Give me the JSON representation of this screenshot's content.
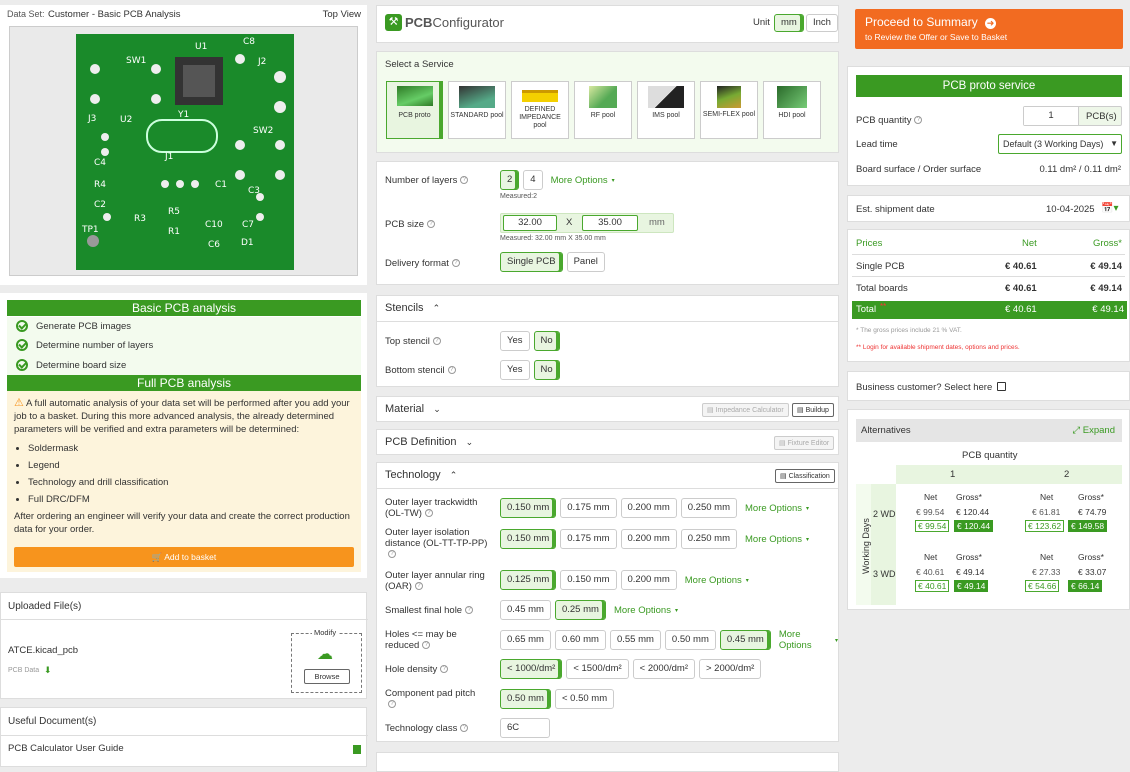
{
  "left": {
    "dataset_label": "Data Set:",
    "dataset_name": "Customer - Basic PCB Analysis",
    "view": "Top View",
    "pcb_labels": [
      "SW1",
      "U1",
      "C8",
      "J2",
      "J3",
      "U2",
      "Y1",
      "SW2",
      "C4",
      "J1",
      "R4",
      "C1",
      "C3",
      "C2",
      "R3",
      "R5",
      "C10",
      "C7",
      "TP1",
      "R1",
      "C6",
      "D1"
    ],
    "basic_title": "Basic PCB analysis",
    "basic_items": [
      "Generate PCB images",
      "Determine number of layers",
      "Determine board size"
    ],
    "full_title": "Full PCB analysis",
    "full_text": "A full automatic analysis of your data set will be performed after you add your job to a basket. During this more advanced analysis, the already determined parameters will be verified and extra parameters will be determined:",
    "full_items": [
      "Soldermask",
      "Legend",
      "Technology and drill classification",
      "Full DRC/DFM"
    ],
    "full_after": "After ordering an engineer will verify your data and create the correct production data for your order.",
    "add_basket": "Add to basket",
    "uploaded_title": "Uploaded File(s)",
    "file_name": "ATCE.kicad_pcb",
    "pcb_data": "PCB Data",
    "modify": "Modify",
    "browse": "Browse",
    "docs_title": "Useful Document(s)",
    "doc_item": "PCB Calculator User Guide"
  },
  "center": {
    "logo_a": "PCB",
    "logo_b": "Configurator",
    "unit_label": "Unit",
    "unit_mm": "mm",
    "unit_inch": "Inch",
    "select_service": "Select a Service",
    "services": [
      "PCB proto",
      "STANDARD pool",
      "DEFINED IMPEDANCE pool",
      "RF pool",
      "IMS pool",
      "SEMI-FLEX pool",
      "HDI pool"
    ],
    "layers_label": "Number of layers",
    "layers": [
      "2",
      "4"
    ],
    "more_options": "More Options",
    "measured_layers": "Measured:2",
    "size_label": "PCB size",
    "size_x": "32.00",
    "size_x_sep": "X",
    "size_y": "35.00",
    "size_unit": "mm",
    "measured_size": "Measured: 32.00 mm X 35.00 mm",
    "delivery_label": "Delivery format",
    "delivery": [
      "Single PCB",
      "Panel"
    ],
    "stencils_title": "Stencils",
    "top_stencil": "Top stencil",
    "bottom_stencil": "Bottom stencil",
    "yes": "Yes",
    "no": "No",
    "material_title": "Material",
    "impedance_calc": "Impedance Calculator",
    "buildup": "Buildup",
    "pcbdef_title": "PCB Definition",
    "fixture_editor": "Fixture Editor",
    "tech_title": "Technology",
    "classification": "Classification",
    "trackwidth_label": "Outer layer trackwidth (OL-TW)",
    "trackwidth": [
      "0.150 mm",
      "0.175 mm",
      "0.200 mm",
      "0.250 mm"
    ],
    "isolation_label": "Outer layer isolation distance (OL-TT-TP-PP)",
    "isolation": [
      "0.150 mm",
      "0.175 mm",
      "0.200 mm",
      "0.250 mm"
    ],
    "ring_label": "Outer layer annular ring (OAR)",
    "ring": [
      "0.125 mm",
      "0.150 mm",
      "0.200 mm"
    ],
    "hole_label": "Smallest final hole",
    "hole": [
      "0.45 mm",
      "0.25 mm"
    ],
    "reduce_label": "Holes <= may be reduced",
    "reduce": [
      "0.65 mm",
      "0.60 mm",
      "0.55 mm",
      "0.50 mm",
      "0.45 mm"
    ],
    "density_label": "Hole density",
    "density": [
      "< 1000/dm²",
      "< 1500/dm²",
      "< 2000/dm²",
      "> 2000/dm²"
    ],
    "pitch_label": "Component pad pitch",
    "pitch": [
      "0.50 mm",
      "< 0.50 mm"
    ],
    "class_label": "Technology class",
    "class_value": "6C"
  },
  "right": {
    "proceed": "Proceed to Summary",
    "proceed_sub": "to Review the Offer or Save to Basket",
    "service_title": "PCB proto service",
    "qty_label": "PCB quantity",
    "qty": "1",
    "qty_unit": "PCB(s)",
    "lead_label": "Lead time",
    "lead_value": "Default (3 Working Days)",
    "surface_label": "Board surface / Order surface",
    "surface_value": "0.11 dm² / 0.11 dm²",
    "ship_label": "Est. shipment date",
    "ship_date": "10-04-2025",
    "prices_h": "Prices",
    "net_h": "Net",
    "gross_h": "Gross*",
    "rows": [
      {
        "name": "Single PCB",
        "net": "€ 40.61",
        "gross": "€ 49.14"
      },
      {
        "name": "Total boards",
        "net": "€ 40.61",
        "gross": "€ 49.14"
      }
    ],
    "total_name": "Total",
    "total_stars": "**",
    "total_net": "€ 40.61",
    "total_gross": "€ 49.14",
    "note1": "* The gross prices include 21 % VAT.",
    "note2": "** Login for available shipment dates, options and prices.",
    "business": "Business customer? Select here",
    "alt_title": "Alternatives",
    "expand": "Expand",
    "alt_qty": "PCB quantity",
    "alt_cols": [
      "1",
      "2"
    ],
    "working_days": "Working Days",
    "alt_rows": [
      {
        "wd": "2 WD",
        "c1": {
          "net": "€ 99.54",
          "gross": "€ 120.44"
        },
        "c2": {
          "net": "€ 61.81",
          "gross": "€ 74.79",
          "bnet": "€ 123.62",
          "bgross": "€ 149.58"
        }
      },
      {
        "wd": "3 WD",
        "c1": {
          "net": "€ 40.61",
          "gross": "€ 49.14"
        },
        "c2": {
          "net": "€ 27.33",
          "gross": "€ 33.07",
          "bnet": "€ 54.66",
          "bgross": "€ 66.14"
        }
      }
    ]
  },
  "colors": {
    "green": "#3a9a22",
    "orange": "#f26b21",
    "btn_orange": "#f7941d"
  }
}
